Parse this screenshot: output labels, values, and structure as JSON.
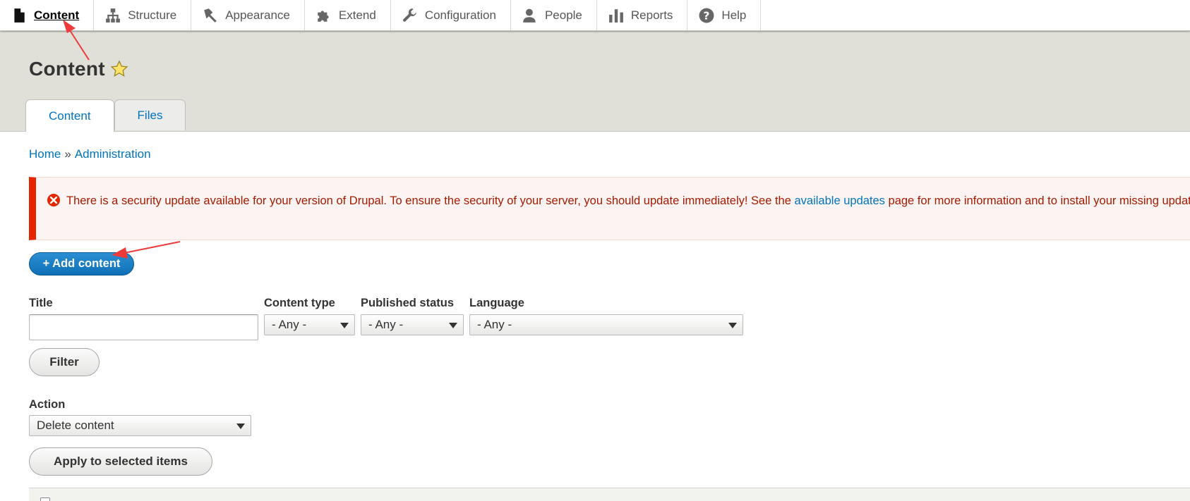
{
  "toolbar": {
    "items": [
      {
        "label": "Content",
        "icon": "file-icon"
      },
      {
        "label": "Structure",
        "icon": "sitemap-icon"
      },
      {
        "label": "Appearance",
        "icon": "paint-brush-icon"
      },
      {
        "label": "Extend",
        "icon": "puzzle-icon"
      },
      {
        "label": "Configuration",
        "icon": "wrench-icon"
      },
      {
        "label": "People",
        "icon": "people-icon"
      },
      {
        "label": "Reports",
        "icon": "bar-chart-icon"
      },
      {
        "label": "Help",
        "icon": "help-icon"
      }
    ]
  },
  "header": {
    "title": "Content",
    "tabs": [
      {
        "label": "Content"
      },
      {
        "label": "Files"
      }
    ]
  },
  "breadcrumb": {
    "home": "Home",
    "separator": "»",
    "administration": "Administration"
  },
  "message": {
    "text_before": "There is a security update available for your version of Drupal. To ensure the security of your server, you should update immediately! See the ",
    "link": "available updates",
    "text_after": " page for more information and to install your missing updates."
  },
  "add_button": "+ Add content",
  "filters": {
    "title_label": "Title",
    "title_value": "",
    "content_type_label": "Content type",
    "content_type_value": "- Any -",
    "published_label": "Published status",
    "published_value": "- Any -",
    "language_label": "Language",
    "language_value": "- Any -",
    "filter_button": "Filter"
  },
  "bulk": {
    "action_label": "Action",
    "action_value": "Delete content",
    "apply_button": "Apply to selected items"
  },
  "colors": {
    "link": "#0074bd",
    "error": "#e62600",
    "primary_button": "#0f6fb6",
    "annotation_arrow": "#ee3a3a"
  }
}
